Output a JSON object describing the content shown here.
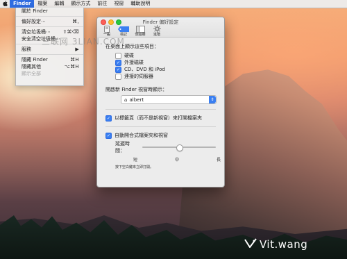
{
  "menubar": {
    "apple": "",
    "items": [
      "Finder",
      "檔案",
      "編輯",
      "顯示方式",
      "前往",
      "視窗",
      "輔助說明"
    ]
  },
  "finder_menu": {
    "items": [
      {
        "label": "關於 Finder",
        "shortcut": ""
      },
      {
        "label": "偏好設定⋯",
        "shortcut": "⌘,"
      },
      {
        "label": "清空垃圾桶⋯",
        "shortcut": "⇧⌘⌫"
      },
      {
        "label": "安全清空垃圾桶⋯",
        "shortcut": ""
      },
      {
        "label": "服務",
        "shortcut": "▶"
      },
      {
        "label": "隱藏 Finder",
        "shortcut": "⌘H"
      },
      {
        "label": "隱藏其他",
        "shortcut": "⌥⌘H"
      },
      {
        "label": "顯示全部",
        "shortcut": ""
      }
    ]
  },
  "watermark": "三联网 3LIAN.COM",
  "window": {
    "title": "Finder 偏好設定",
    "toolbar": [
      "一般",
      "標記",
      "側邊欄",
      "進階"
    ],
    "desktop_section": {
      "heading": "在桌面上顯示這些項目：",
      "items": [
        {
          "label": "硬碟",
          "checked": false
        },
        {
          "label": "外接磁碟",
          "checked": true
        },
        {
          "label": "CD、DVD 和 iPod",
          "checked": true
        },
        {
          "label": "連接的伺服器",
          "checked": false
        }
      ]
    },
    "new_window": {
      "heading": "開啟新 Finder 視窗時顯示：",
      "value": "albert"
    },
    "open_tabs": {
      "label": "以標籤頁（而不是新視窗）來打開檔案夾",
      "checked": true
    },
    "spring_loaded": {
      "label": "自動開合式檔案夾和視窗",
      "checked": true
    },
    "delay": {
      "label": "延遲時間：",
      "level": 0.5,
      "ticks": [
        "短",
        "中",
        "長"
      ],
      "hint": "按下空白鍵來立即打開。"
    }
  },
  "logo": "Vit.wang"
}
